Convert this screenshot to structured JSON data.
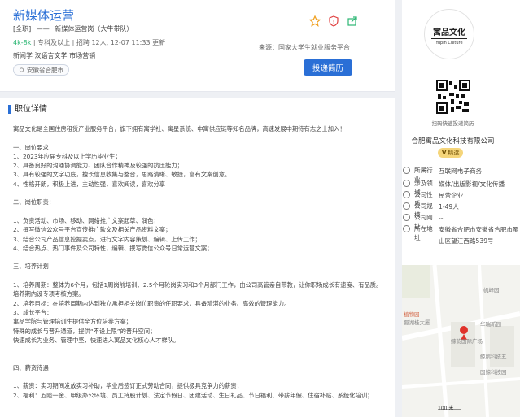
{
  "header": {
    "title": "新媒体运营",
    "tag": "[全职]",
    "dash": "——",
    "dept": "新媒体运营岗（大牛带队）",
    "salary": "4k-8k",
    "meta": "| 专科及以上 | 招聘 12人, 12-07 11:33 更新",
    "majors": "新闻学 汉语言文学 市场营销",
    "source": "来源：国家大学生就业服务平台",
    "location": "安徽省合肥市",
    "apply_label": "投递简历"
  },
  "detail": {
    "section_title": "职位详情",
    "paragraphs": [
      "寓品文化是全国住房租赁产业服务平台，旗下拥有寓学社、寓星系统、中寓供应链等知名品牌，高速发展中期待有志之士加入！",
      "",
      "一、岗位要求",
      "1、2023年应届专科及以上学历毕业生；",
      "2、具备良好的沟通协调能力、团队合作精神及较强的抗压能力；",
      "3、具有较强的文字功底，擅长信息收集与整合，思路清晰、敏捷，富有文案创意。",
      "4、性格开朗，积极上进，主动性强，喜欢阅读，喜欢分享",
      "",
      "二、岗位职责：",
      "",
      "1、负责活动、市场、移动、网络推广文案起草、润色；",
      "2、撰写微信公众号平台宣传推广软文及相关产品资料文案；",
      "3、结合公司产品信息挖掘卖点，进行文字内容策划、编辑、上传工作；",
      "4、结合热点、热门事件及公司特性，编辑、撰写微信公众号日常运营文案；",
      "",
      "三、培养计划",
      "",
      "1、培养周期：整体为6个月，包括1周岗前培训、2.5个月轮岗实习和3个月部门工作，由公司高管亲自带教，让你职场成长有速度、有品质。培养期内设专项考核方案。",
      "2、培养目标：在培养周期内达到独立承担相关岗位职责的任职要求，具备精湛的业务、高效的管理能力。",
      "3、成长平台：",
      "寓品学院与管理培训生提供全方位培养方案；",
      "特殊的成长与晋升通道，提供“不设上限”的晋升空间；",
      "快速成长为业务、管理中坚，快速进入寓品文化核心人才梯队。",
      "",
      "",
      "四、薪资待遇",
      "",
      "1、薪资：实习期间发放实习补助，毕业后签订正式劳动合同，提供极具竞争力的薪资；",
      "2、福利：五险一金、甲级办公环境、员工持股计划、法定节假日、团建活动、生日礼品、节日福利、带薪年假、住宿补贴、系统化培训；"
    ]
  },
  "company": {
    "logo_cn": "寓品文化",
    "logo_en": "Yupin Culture",
    "qr_text": "扫码快速投递简历",
    "name": "合肥寓品文化科技有限公司",
    "badge": "精选",
    "info": [
      {
        "icon": "industry-icon",
        "label": "所属行业",
        "value": "互联网电子商务"
      },
      {
        "icon": "business-icon",
        "label": "涉及领域",
        "value": "媒体/出版影视/文化传播"
      },
      {
        "icon": "nature-icon",
        "label": "公司性质",
        "value": "民营企业"
      },
      {
        "icon": "scale-icon",
        "label": "公司规模",
        "value": "1-49人"
      },
      {
        "icon": "website-icon",
        "label": "公司网址",
        "value": "--"
      },
      {
        "icon": "address-icon",
        "label": "所在地址",
        "value": "安徽省合肥市安徽省合肥市蜀山区望江西路539号"
      }
    ]
  },
  "map": {
    "labels": [
      "帆峰园",
      "植物园",
      "蜀湖桂大厦",
      "华瑞新园",
      "鲸韵国际广场",
      "鲸鹏科技五",
      "国鲸科技园"
    ],
    "scale": "100 米"
  }
}
